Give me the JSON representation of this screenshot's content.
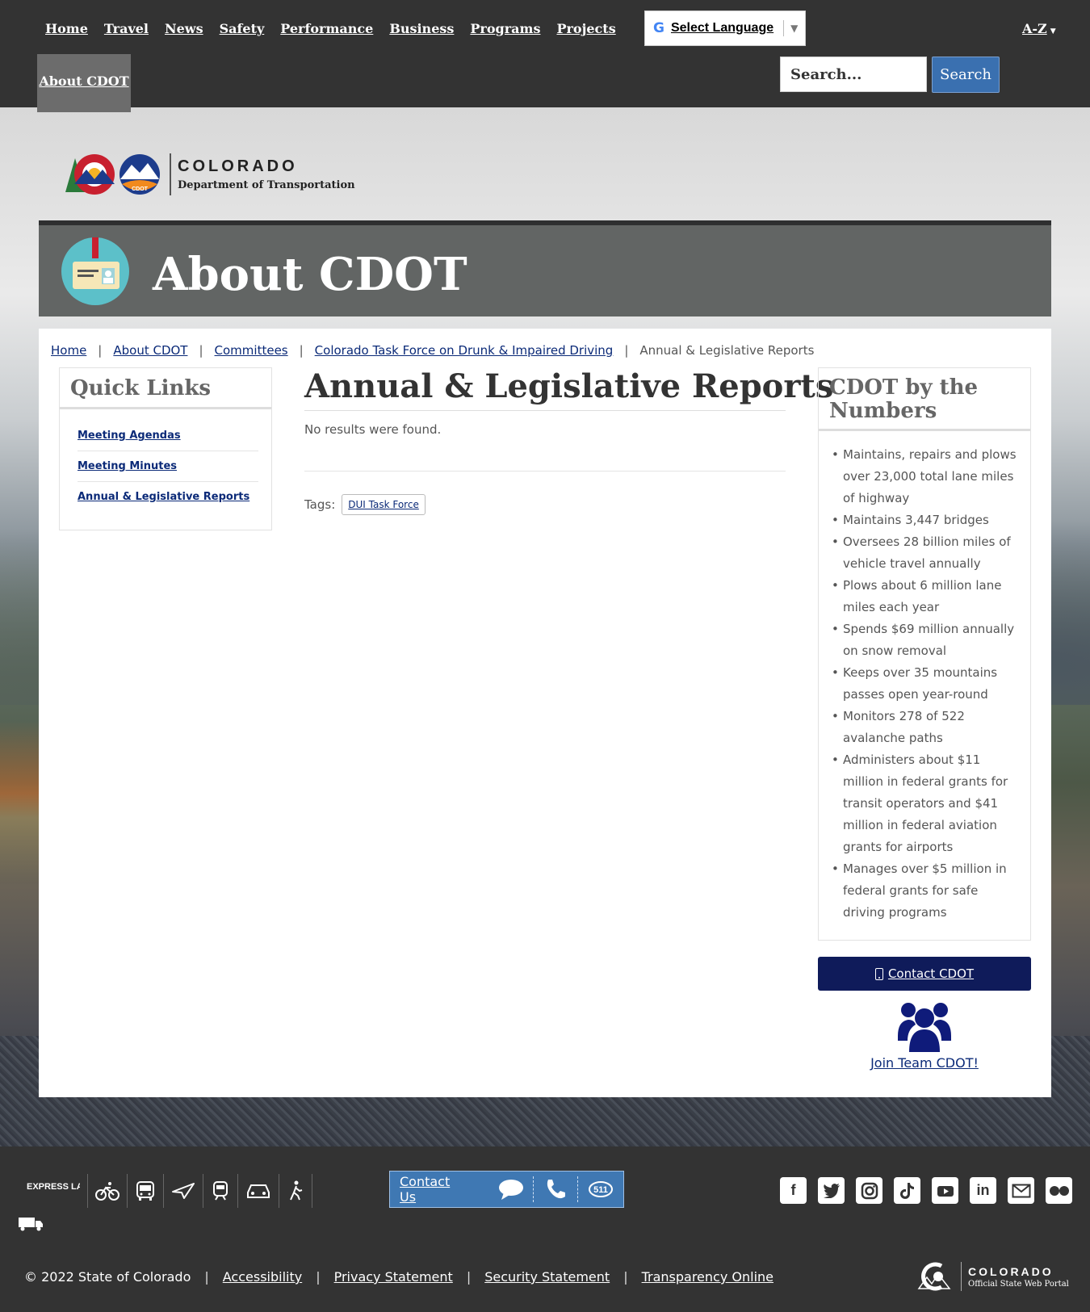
{
  "topnav": {
    "items": [
      "Home",
      "Travel",
      "News",
      "Safety",
      "Performance",
      "Business",
      "Programs",
      "Projects"
    ],
    "active_tab": "About CDOT",
    "language_label": "Select Language",
    "az_label": "A-Z",
    "search_placeholder": "Search...",
    "search_button": "Search"
  },
  "logo": {
    "name": "COLORADO",
    "subtitle": "Department of Transportation",
    "badge": "CDOT"
  },
  "banner": {
    "title": "About CDOT",
    "icon": "id-badge-icon",
    "circle_color": "#5cc0c9"
  },
  "breadcrumb": {
    "items": [
      "Home",
      "About CDOT",
      "Committees",
      "Colorado Task Force on Drunk & Impaired Driving"
    ],
    "current": "Annual & Legislative Reports"
  },
  "quick_links": {
    "title": "Quick Links",
    "items": [
      "Meeting Agendas",
      "Meeting Minutes",
      "Annual & Legislative Reports"
    ]
  },
  "main": {
    "title": "Annual & Legislative Reports",
    "no_results": "No results were found.",
    "tags_label": "Tags:",
    "tag": "DUI Task Force"
  },
  "by_numbers": {
    "title": "CDOT by the Numbers",
    "items": [
      "Maintains, repairs and plows over 23,000 total lane miles of highway",
      "Maintains 3,447 bridges",
      "Oversees 28 billion miles of vehicle travel annually",
      "Plows about 6 million lane miles each year",
      "Spends $69 million annually on snow removal",
      "Keeps over 35 mountains passes open year-round",
      "Monitors 278 of 522 avalanche paths",
      "Administers about $11 million in federal grants for transit operators and $41 million in federal aviation grants for airports",
      "Manages over $5 million in federal grants for safe driving programs"
    ]
  },
  "sidebar_actions": {
    "contact_label": "Contact CDOT",
    "join_label": "Join Team CDOT!"
  },
  "footer": {
    "modes": [
      "express-lanes-icon",
      "bike-icon",
      "bus-icon",
      "plane-icon",
      "train-icon",
      "car-icon",
      "pedestrian-icon",
      "truck-icon"
    ],
    "express_lanes_text": "EXPRESS LANES",
    "contact_label": "Contact Us",
    "contact_511": "511",
    "social": [
      "facebook-icon",
      "twitter-icon",
      "instagram-icon",
      "tiktok-icon",
      "youtube-icon",
      "linkedin-icon",
      "email-icon",
      "flickr-icon"
    ],
    "copyright": "© 2022 State of Colorado",
    "links": [
      "Accessibility",
      "Privacy Statement",
      "Security Statement",
      "Transparency Online"
    ],
    "portal_name": "COLORADO",
    "portal_subtitle": "Official State Web Portal"
  }
}
